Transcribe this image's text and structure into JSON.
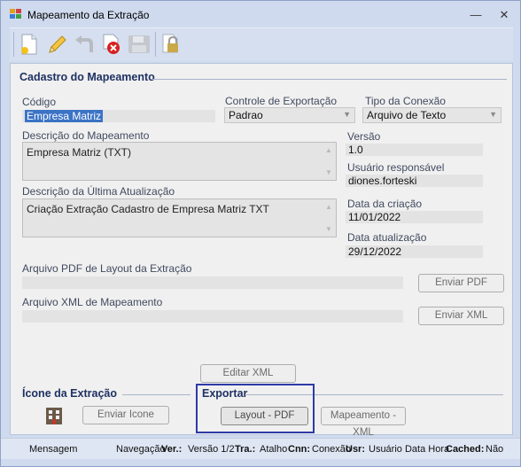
{
  "window": {
    "title": "Mapeamento da Extração",
    "minimize": "—",
    "close": "✕"
  },
  "toolbar": {
    "icons": [
      "new-icon",
      "edit-icon",
      "undo-icon",
      "delete-icon",
      "save-icon",
      "lock-icon"
    ]
  },
  "cadastro": {
    "group_title": "Cadastro do Mapeamento",
    "codigo_label": "Código",
    "codigo_value": "Empresa Matriz",
    "controle_label": "Controle de Exportação",
    "controle_value": "Padrao",
    "tipo_label": "Tipo da Conexão",
    "tipo_value": "Arquivo de Texto",
    "descricao_label": "Descrição do Mapeamento",
    "descricao_value": "Empresa Matriz (TXT)",
    "versao_label": "Versão",
    "versao_value": "1.0",
    "usuario_label": "Usuário responsável",
    "usuario_value": "diones.forteski",
    "ultima_label": "Descrição da Última Atualização",
    "ultima_value": "Criação Extração Cadastro de Empresa Matriz TXT",
    "criacao_label": "Data da criação",
    "criacao_value": "11/01/2022",
    "atualizacao_label": "Data atualização",
    "atualizacao_value": "29/12/2022",
    "pdf_label": "Arquivo PDF de Layout da Extração",
    "pdf_value": "",
    "xml_label": "Arquivo XML de Mapeamento",
    "xml_value": "",
    "enviar_pdf": "Enviar PDF",
    "enviar_xml": "Enviar XML",
    "editar_xml": "Editar XML"
  },
  "icone": {
    "group_title": "Ícone da Extração",
    "enviar_icone": "Enviar Icone"
  },
  "exportar": {
    "group_title": "Exportar",
    "layout_pdf": "Layout - PDF",
    "mapeamento_xml": "Mapeamento - XML"
  },
  "status": {
    "mensagem": "Mensagem",
    "navegacao": "Navegação",
    "ver_label": "Ver.:",
    "ver_value": "Versão 1/2",
    "tra_label": "Tra.:",
    "tra_value": "Atalho",
    "cnn_label": "Cnn:",
    "cnn_value": "Conexão",
    "usr_label": "Usr:",
    "usr_value": "Usuário Data Hora",
    "cached_label": "Cached:",
    "cached_value": "Não"
  }
}
